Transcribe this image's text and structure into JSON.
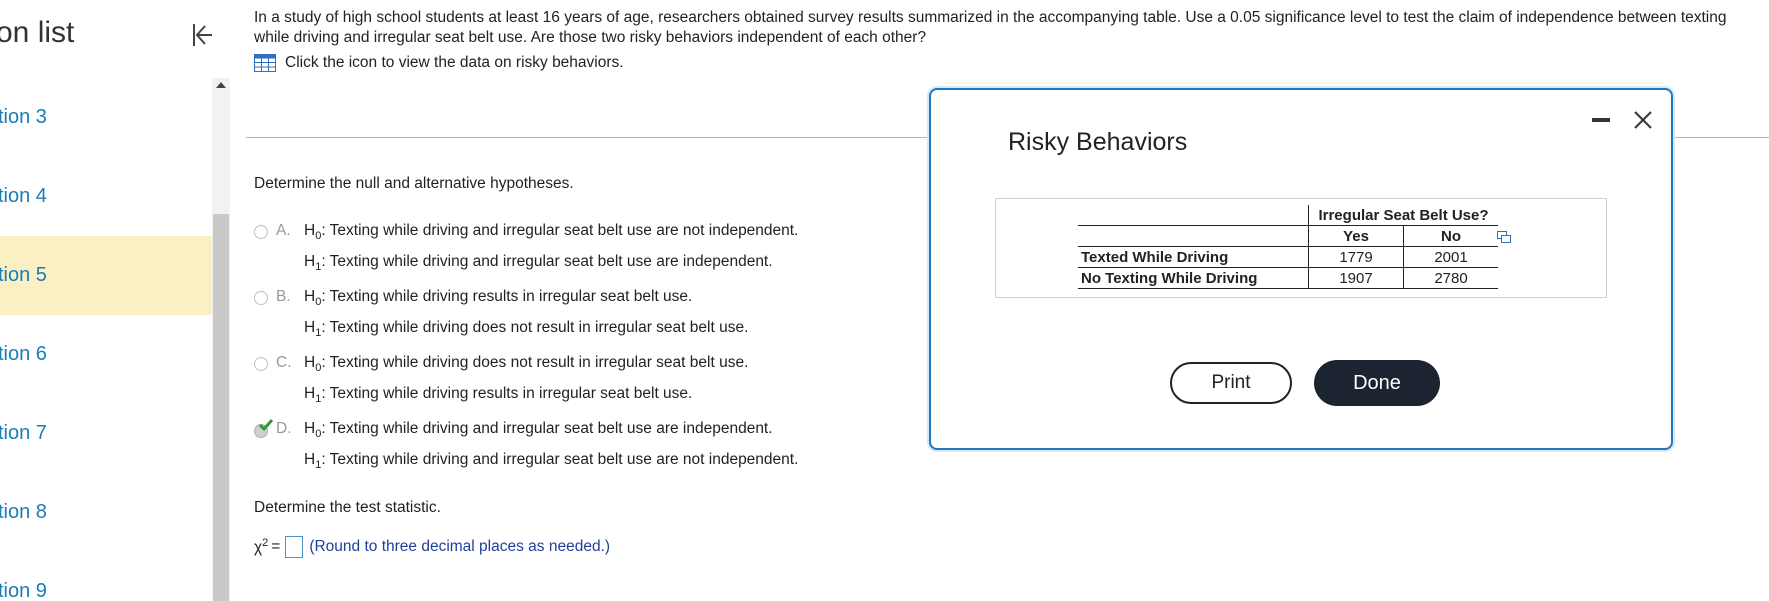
{
  "sidebar": {
    "title": "on list",
    "items": [
      {
        "label": "tion 3"
      },
      {
        "label": "tion 4"
      },
      {
        "label": "tion 5"
      },
      {
        "label": "tion 6"
      },
      {
        "label": "tion 7"
      },
      {
        "label": "tion 8"
      },
      {
        "label": "tion 9"
      }
    ],
    "active_index": 2
  },
  "question": {
    "intro": "In a study of high school students at least 16 years of age, researchers obtained survey results summarized in the accompanying table. Use a 0.05 significance level to test the claim of independence between texting while driving and irregular seat belt use. Are those two risky behaviors independent of each other?",
    "data_link": "Click the icon to view the data on risky behaviors.",
    "hypotheses_prompt": "Determine the null and alternative hypotheses.",
    "options": [
      {
        "letter": "A.",
        "h0_sym": "H",
        "h0_sub": "0",
        "h0_text": ": Texting while driving and irregular seat belt use are not independent.",
        "h1_sym": "H",
        "h1_sub": "1",
        "h1_text": ": Texting while driving and irregular seat belt use are independent."
      },
      {
        "letter": "B.",
        "h0_sym": "H",
        "h0_sub": "0",
        "h0_text": ": Texting while driving results in irregular seat belt use.",
        "h1_sym": "H",
        "h1_sub": "1",
        "h1_text": ": Texting while driving does not result in irregular seat belt use."
      },
      {
        "letter": "C.",
        "h0_sym": "H",
        "h0_sub": "0",
        "h0_text": ": Texting while driving does not result in irregular seat belt use.",
        "h1_sym": "H",
        "h1_sub": "1",
        "h1_text": ": Texting while driving results in irregular seat belt use."
      },
      {
        "letter": "D.",
        "h0_sym": "H",
        "h0_sub": "0",
        "h0_text": ": Texting while driving and irregular seat belt use are independent.",
        "h1_sym": "H",
        "h1_sub": "1",
        "h1_text": ": Texting while driving and irregular seat belt use are not independent."
      }
    ],
    "selected_option": "D.",
    "stat_prompt": "Determine the test statistic.",
    "chi_symbol": "χ",
    "chi_sup": "2",
    "equals": "=",
    "round_hint": "(Round to three decimal places as needed.)"
  },
  "modal": {
    "title": "Risky Behaviors",
    "table": {
      "group_header": "Irregular Seat Belt Use?",
      "col_headers": [
        "Yes",
        "No"
      ],
      "rows": [
        {
          "label": "Texted While Driving",
          "values": [
            "1779",
            "2001"
          ]
        },
        {
          "label": "No Texting While Driving",
          "values": [
            "1907",
            "2780"
          ]
        }
      ]
    },
    "print_label": "Print",
    "done_label": "Done"
  },
  "colors": {
    "accent_blue": "#1e78c1",
    "link_blue": "#1a7db5",
    "active_bg": "#faf0c4",
    "check_green": "#2e9b3a",
    "done_bg": "#1b2430"
  }
}
